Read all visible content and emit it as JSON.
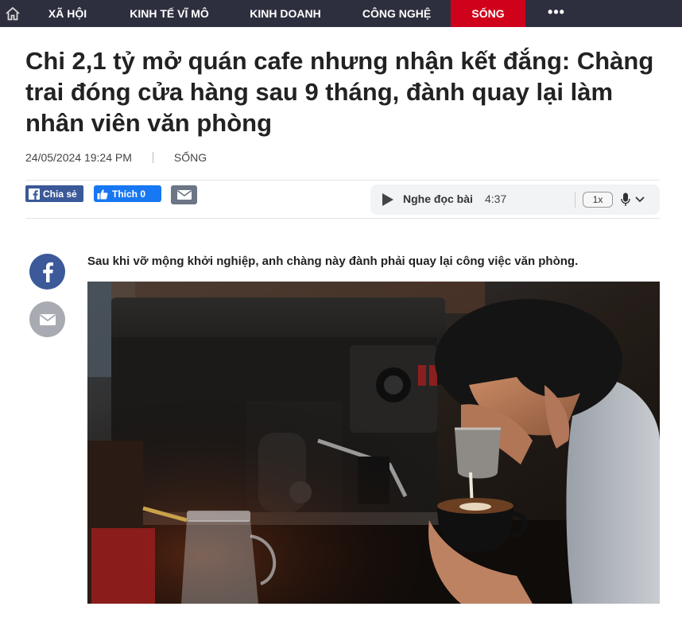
{
  "nav": {
    "home_icon": "home-icon",
    "items": [
      {
        "label": "XÃ HỘI"
      },
      {
        "label": "KINH TẾ VĨ MÔ"
      },
      {
        "label": "KINH DOANH"
      },
      {
        "label": "CÔNG NGHỆ"
      },
      {
        "label": "SỐNG"
      }
    ],
    "active_item": "SỐNG",
    "more": "•••",
    "colors": {
      "bar": "#2d2f3e",
      "active": "#d0021b"
    }
  },
  "article": {
    "title": "Chi 2,1 tỷ mở quán cafe nhưng nhận kết đắng: Chàng trai đóng cửa hàng sau 9 tháng, đành quay lại làm nhân viên văn phòng",
    "date": "24/05/2024 19:24 PM",
    "category": "SỐNG",
    "sapo": "Sau khi vỡ mộng khởi nghiệp, anh chàng này đành phải quay lại công việc văn phòng."
  },
  "share": {
    "share_label": "Chia sẻ",
    "like_label": "Thích 0",
    "email_icon": "email-icon"
  },
  "player": {
    "label": "Nghe đọc bài",
    "duration": "4:37",
    "speed": "1x",
    "voice_icon": "microphone-icon"
  },
  "side": {
    "facebook_icon": "facebook-icon",
    "email_icon": "email-icon"
  },
  "photo": {
    "subject": "barista-pouring-latte"
  }
}
